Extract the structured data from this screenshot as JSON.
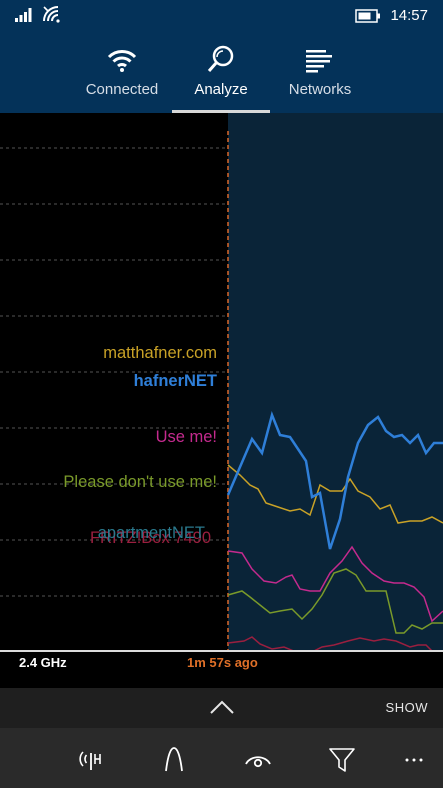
{
  "status_bar": {
    "time": "14:57"
  },
  "tabs": [
    {
      "label": "Connected",
      "icon": "wifi-icon",
      "active": false
    },
    {
      "label": "Analyze",
      "icon": "magnifier-icon",
      "active": true
    },
    {
      "label": "Networks",
      "icon": "networks-list-icon",
      "active": false
    }
  ],
  "networks": [
    {
      "ssid": "matthafner.com",
      "color": "#c9a227"
    },
    {
      "ssid": "hafnerNET",
      "color": "#2f7fd8",
      "connected": true
    },
    {
      "ssid": "Use me!",
      "color": "#c42a8e"
    },
    {
      "ssid": "Please don't use me!",
      "color": "#7a9a2a"
    },
    {
      "ssid": "apartmentNET",
      "color": "#2a7a8e"
    },
    {
      "ssid": "FRITZ!Box 7490",
      "color": "#9a1f3f"
    }
  ],
  "footer": {
    "band": "2.4 GHz",
    "elapsed": "1m 57s ago",
    "show_label": "SHOW"
  },
  "app_bar": {
    "buttons": [
      "signal-antenna-icon",
      "channel-curve-icon",
      "eye-icon",
      "filter-icon",
      "more-icon"
    ]
  },
  "colors": {
    "header_bg": "#043259",
    "marker": "#d9682a",
    "chart_fill": "#0a2438"
  }
}
